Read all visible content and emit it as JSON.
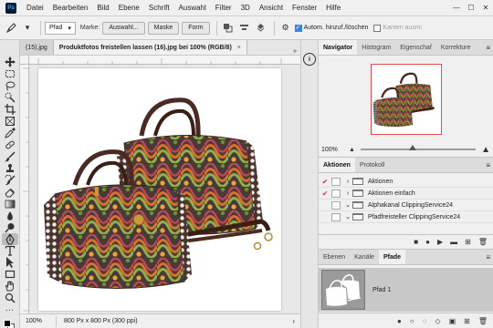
{
  "app": {
    "logo_text": "Ps"
  },
  "menu": [
    "Datei",
    "Bearbeiten",
    "Bild",
    "Ebene",
    "Schrift",
    "Auswahl",
    "Filter",
    "3D",
    "Ansicht",
    "Fenster",
    "Hilfe"
  ],
  "window_controls": {
    "minimize": "—",
    "maximize": "☐",
    "close": "✕"
  },
  "options": {
    "mode_value": "Pfad",
    "marke_label": "Marke:",
    "auswahl_button": "Auswahl...",
    "maske_button": "Maske",
    "form_button": "Form",
    "auto_add_label": "Autom. hinzuf./löschen",
    "auto_add_checked": true,
    "kanten_label": "Kanten ausric"
  },
  "tabs": [
    {
      "label": "(15).jpg",
      "active": false
    },
    {
      "label": "Produktfotos freistellen lassen (16).jpg bei 100% (RGB/8)",
      "active": true
    }
  ],
  "tab_close": "×",
  "tab_more": "»",
  "status": {
    "zoom": "100%",
    "info": "800 Px x 800 Px (300 ppi)",
    "arrow": "›"
  },
  "strip": {
    "info_icon": "i"
  },
  "navigator": {
    "tabs": [
      "Navigator",
      "Histogram",
      "Eigenschaf",
      "Korrekture"
    ],
    "active": 0,
    "zoom": "100%",
    "slider_fraction": 0.45
  },
  "actions": {
    "tabs": [
      "Aktionen",
      "Protokoll"
    ],
    "active": 0,
    "rows": [
      {
        "checked": true,
        "expanded": false,
        "label": "Aktionen"
      },
      {
        "checked": true,
        "expanded": false,
        "label": "Aktionen einfach"
      },
      {
        "checked": false,
        "expanded": true,
        "label": "Alphakanal ClippingService24"
      },
      {
        "checked": false,
        "expanded": true,
        "label": "Pfadfreisteller ClippingService24"
      }
    ],
    "footer": [
      "■",
      "●",
      "▶",
      "▬",
      "⊞",
      "🗑"
    ]
  },
  "layers": {
    "tabs": [
      "Ebenen",
      "Kanäle",
      "Pfade"
    ],
    "active": 2,
    "paths": [
      {
        "label": "Pfad 1"
      }
    ],
    "footer": [
      "●",
      "○",
      "◌",
      "◇",
      "▣",
      "⊞",
      "🗑"
    ]
  },
  "colors": {
    "accent_red": "#e34b4b",
    "check_red": "#d33333",
    "panel_bg": "#f0f0f0"
  }
}
